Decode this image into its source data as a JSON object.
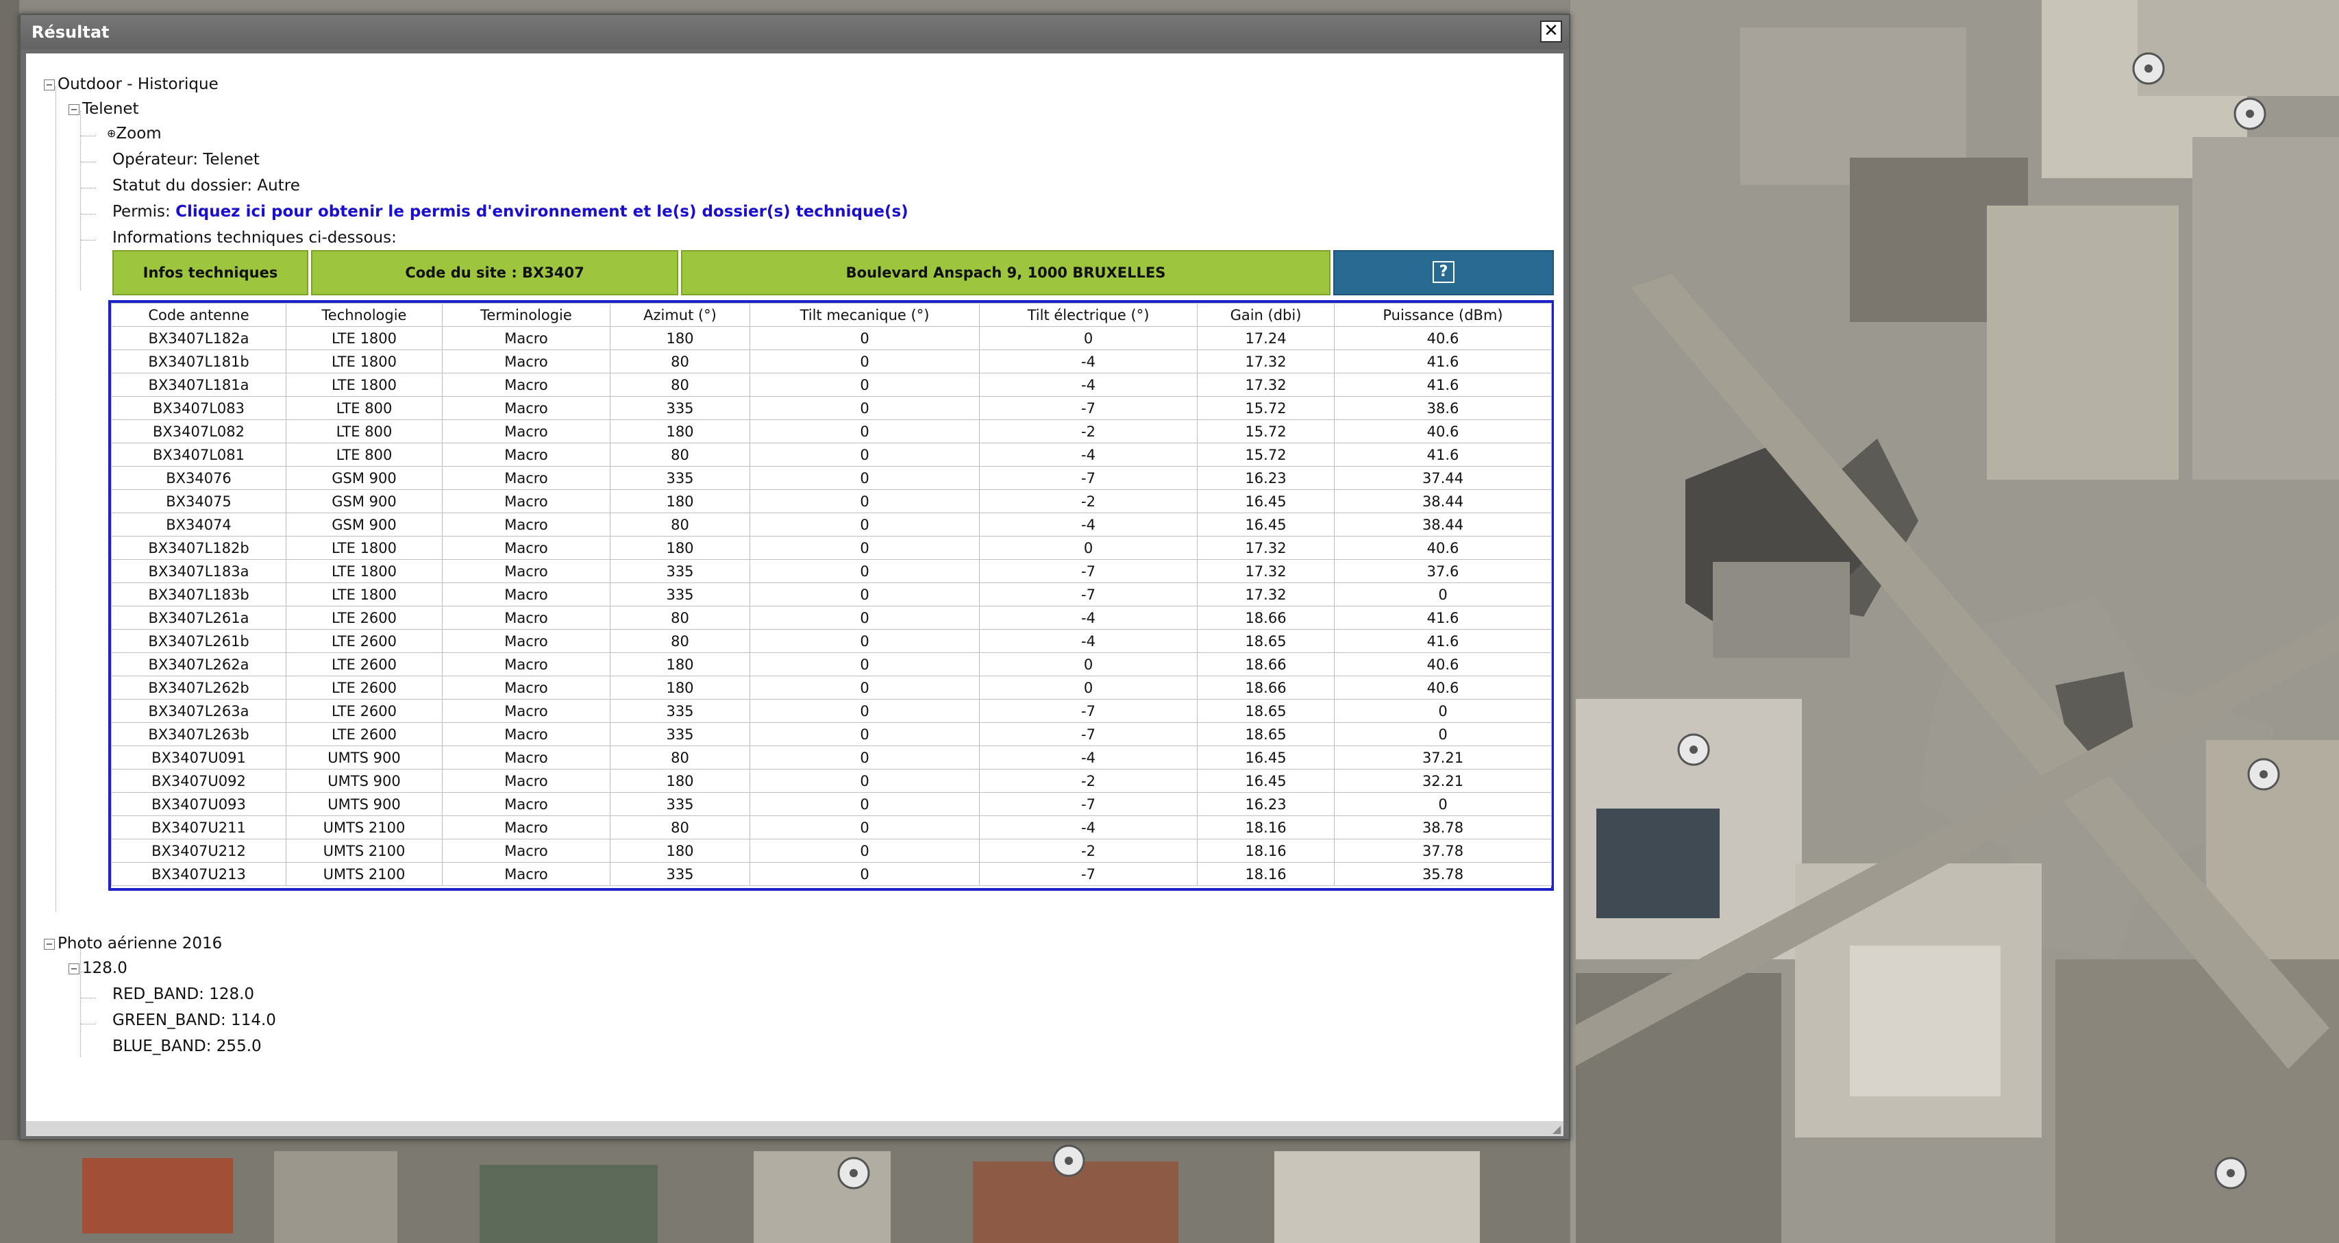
{
  "window": {
    "title": "Résultat",
    "close_label": "✕"
  },
  "tree": {
    "root_label": "Outdoor - Historique",
    "operator_node_label": "Telenet",
    "zoom_label": "Zoom",
    "operator_line": "Opérateur: Telenet",
    "status_line": "Statut du dossier: Autre",
    "permit_label": "Permis:",
    "permit_link": "Cliquez ici pour obtenir le permis d'environnement et le(s) dossier(s) technique(s)",
    "info_line": "Informations techniques ci-dessous:",
    "photo_label": "Photo aérienne 2016",
    "value_node_label": "128.0",
    "bands": [
      "RED_BAND: 128.0",
      "GREEN_BAND: 114.0",
      "BLUE_BAND: 255.0"
    ]
  },
  "info_bar": {
    "infos": "Infos techniques",
    "site_code": "Code du site : BX3407",
    "address": "Boulevard Anspach 9, 1000 BRUXELLES",
    "help_icon": "?"
  },
  "table": {
    "headers": [
      "Code antenne",
      "Technologie",
      "Terminologie",
      "Azimut (°)",
      "Tilt mecanique (°)",
      "Tilt électrique (°)",
      "Gain (dbi)",
      "Puissance (dBm)"
    ],
    "rows": [
      [
        "BX3407L182a",
        "LTE 1800",
        "Macro",
        "180",
        "0",
        "0",
        "17.24",
        "40.6"
      ],
      [
        "BX3407L181b",
        "LTE 1800",
        "Macro",
        "80",
        "0",
        "-4",
        "17.32",
        "41.6"
      ],
      [
        "BX3407L181a",
        "LTE 1800",
        "Macro",
        "80",
        "0",
        "-4",
        "17.32",
        "41.6"
      ],
      [
        "BX3407L083",
        "LTE 800",
        "Macro",
        "335",
        "0",
        "-7",
        "15.72",
        "38.6"
      ],
      [
        "BX3407L082",
        "LTE 800",
        "Macro",
        "180",
        "0",
        "-2",
        "15.72",
        "40.6"
      ],
      [
        "BX3407L081",
        "LTE 800",
        "Macro",
        "80",
        "0",
        "-4",
        "15.72",
        "41.6"
      ],
      [
        "BX34076",
        "GSM 900",
        "Macro",
        "335",
        "0",
        "-7",
        "16.23",
        "37.44"
      ],
      [
        "BX34075",
        "GSM 900",
        "Macro",
        "180",
        "0",
        "-2",
        "16.45",
        "38.44"
      ],
      [
        "BX34074",
        "GSM 900",
        "Macro",
        "80",
        "0",
        "-4",
        "16.45",
        "38.44"
      ],
      [
        "BX3407L182b",
        "LTE 1800",
        "Macro",
        "180",
        "0",
        "0",
        "17.32",
        "40.6"
      ],
      [
        "BX3407L183a",
        "LTE 1800",
        "Macro",
        "335",
        "0",
        "-7",
        "17.32",
        "37.6"
      ],
      [
        "BX3407L183b",
        "LTE 1800",
        "Macro",
        "335",
        "0",
        "-7",
        "17.32",
        "0"
      ],
      [
        "BX3407L261a",
        "LTE 2600",
        "Macro",
        "80",
        "0",
        "-4",
        "18.66",
        "41.6"
      ],
      [
        "BX3407L261b",
        "LTE 2600",
        "Macro",
        "80",
        "0",
        "-4",
        "18.65",
        "41.6"
      ],
      [
        "BX3407L262a",
        "LTE 2600",
        "Macro",
        "180",
        "0",
        "0",
        "18.66",
        "40.6"
      ],
      [
        "BX3407L262b",
        "LTE 2600",
        "Macro",
        "180",
        "0",
        "0",
        "18.66",
        "40.6"
      ],
      [
        "BX3407L263a",
        "LTE 2600",
        "Macro",
        "335",
        "0",
        "-7",
        "18.65",
        "0"
      ],
      [
        "BX3407L263b",
        "LTE 2600",
        "Macro",
        "335",
        "0",
        "-7",
        "18.65",
        "0"
      ],
      [
        "BX3407U091",
        "UMTS 900",
        "Macro",
        "80",
        "0",
        "-4",
        "16.45",
        "37.21"
      ],
      [
        "BX3407U092",
        "UMTS 900",
        "Macro",
        "180",
        "0",
        "-2",
        "16.45",
        "32.21"
      ],
      [
        "BX3407U093",
        "UMTS 900",
        "Macro",
        "335",
        "0",
        "-7",
        "16.23",
        "0"
      ],
      [
        "BX3407U211",
        "UMTS 2100",
        "Macro",
        "80",
        "0",
        "-4",
        "18.16",
        "38.78"
      ],
      [
        "BX3407U212",
        "UMTS 2100",
        "Macro",
        "180",
        "0",
        "-2",
        "18.16",
        "37.78"
      ],
      [
        "BX3407U213",
        "UMTS 2100",
        "Macro",
        "335",
        "0",
        "-7",
        "18.16",
        "35.78"
      ]
    ]
  },
  "map": {
    "antenna_icon": "antenna-marker-icon"
  },
  "colors": {
    "info_green": "#9dc53e",
    "help_blue": "#296a93",
    "table_border": "#1d22c8",
    "link_blue": "#1a0fd0"
  }
}
